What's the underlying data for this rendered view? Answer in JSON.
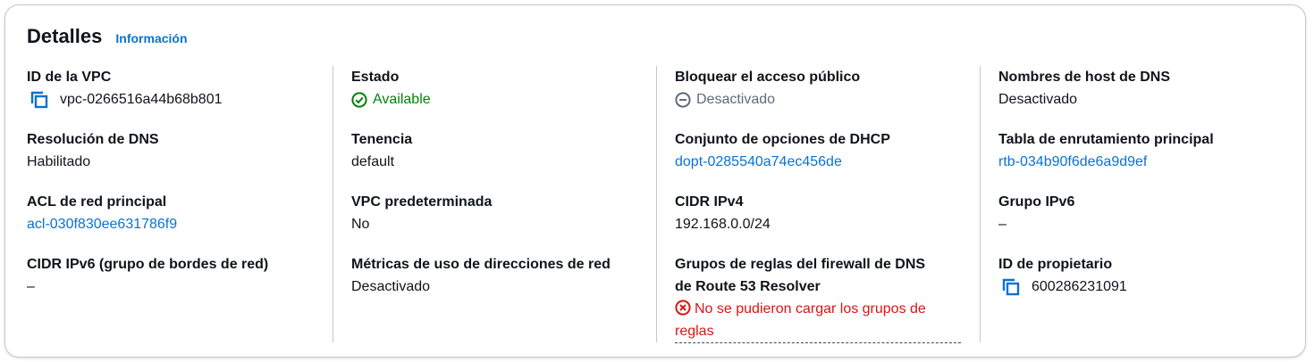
{
  "header": {
    "title": "Detalles",
    "info_link": "Información"
  },
  "colors": {
    "link": "#0972d3",
    "success": "#037f0c",
    "error": "#d91515",
    "muted": "#5f6b7a"
  },
  "columns": [
    {
      "items": [
        {
          "label": "ID de la VPC",
          "value": "vpc-0266516a44b68b801",
          "icon": "copy-icon"
        },
        {
          "label": "Resolución de DNS",
          "value": "Habilitado"
        },
        {
          "label": "ACL de red principal",
          "value": "acl-030f830ee631786f9",
          "link": true
        },
        {
          "label": "CIDR IPv6 (grupo de bordes de red)",
          "value": "–"
        }
      ]
    },
    {
      "items": [
        {
          "label": "Estado",
          "value": "Available",
          "icon": "check-circle-icon",
          "status": "success"
        },
        {
          "label": "Tenencia",
          "value": "default"
        },
        {
          "label": "VPC predeterminada",
          "value": "No"
        },
        {
          "label": "Métricas de uso de direcciones de red",
          "value": "Desactivado"
        }
      ]
    },
    {
      "items": [
        {
          "label": "Bloquear el acceso público",
          "value": "Desactivado",
          "icon": "minus-circle-icon",
          "status": "muted"
        },
        {
          "label": "Conjunto de opciones de DHCP",
          "value": "dopt-0285540a74ec456de",
          "link": true
        },
        {
          "label": "CIDR IPv4",
          "value": "192.168.0.0/24"
        },
        {
          "label_line1": "Grupos de reglas del firewall de DNS",
          "label_line2": "de Route 53 Resolver",
          "error_line1": "No se pudieron cargar los grupos de",
          "error_line2": "reglas",
          "icon": "x-circle-icon"
        }
      ]
    },
    {
      "items": [
        {
          "label": "Nombres de host de DNS",
          "value": "Desactivado"
        },
        {
          "label": "Tabla de enrutamiento principal",
          "value": "rtb-034b90f6de6a9d9ef",
          "link": true
        },
        {
          "label": "Grupo IPv6",
          "value": "–"
        },
        {
          "label": "ID de propietario",
          "value": "600286231091",
          "icon": "copy-icon"
        }
      ]
    }
  ]
}
